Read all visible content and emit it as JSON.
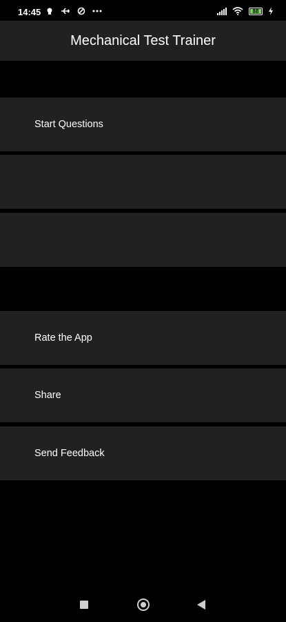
{
  "status_bar": {
    "time": "14:45",
    "battery": "88"
  },
  "app_bar": {
    "title": "Mechanical Test Trainer"
  },
  "menu": {
    "start_questions": "Start Questions",
    "rate_app": "Rate the App",
    "share": "Share",
    "send_feedback": "Send Feedback"
  },
  "colors": {
    "background": "#000000",
    "surface": "#212121",
    "text": "#ffffff",
    "battery_fill": "#7ed957"
  },
  "icons": {
    "status_left": [
      "notification-icon",
      "airplane-icon",
      "sync-icon",
      "more-icon"
    ],
    "status_right": [
      "signal-icon",
      "wifi-icon",
      "battery-icon",
      "charging-icon"
    ],
    "nav": [
      "recents-icon",
      "home-icon",
      "back-icon"
    ]
  }
}
